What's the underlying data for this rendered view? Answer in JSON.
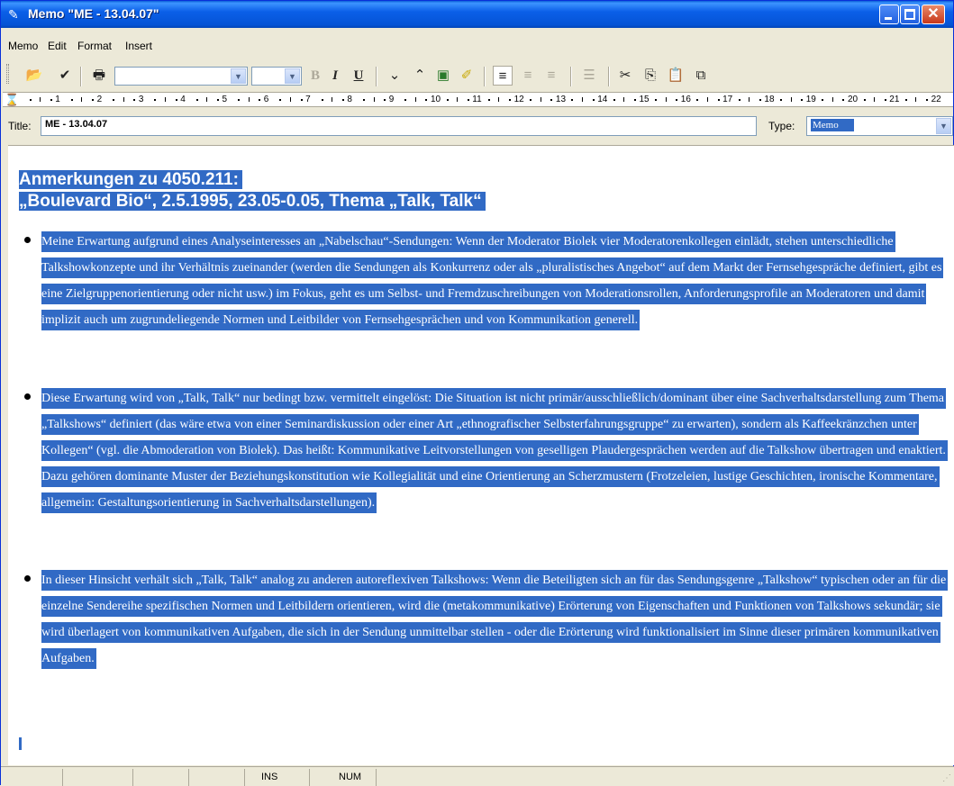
{
  "window": {
    "title": "Memo \"ME - 13.04.07\"",
    "close_glyph": "✕"
  },
  "menu": [
    "Memo",
    "Edit",
    "Format",
    "Insert"
  ],
  "toolbar": {
    "font_name": "",
    "font_size": "",
    "bold_label": "B",
    "italic_label": "I",
    "underline_label": "U",
    "icons": [
      "open-icon",
      "check-icon",
      "print-icon",
      "font-combo",
      "size-combo",
      "bold-icon",
      "italic-icon",
      "underline-icon",
      "move-down-icon",
      "move-up-icon",
      "color-icon",
      "highlight-icon",
      "align-left-icon",
      "align-center-icon",
      "align-right-icon",
      "bullets-icon",
      "cut-icon",
      "copy-icon",
      "paste-icon",
      "paste-special-icon"
    ]
  },
  "ruler": {
    "numbers": [
      "1",
      "2",
      "3",
      "4",
      "5",
      "6",
      "7",
      "8",
      "9",
      "10",
      "11",
      "12",
      "13",
      "14",
      "15",
      "16",
      "17",
      "18",
      "19",
      "20",
      "21",
      "22"
    ]
  },
  "fields": {
    "title_label": "Title:",
    "title_value": "ME - 13.04.07",
    "type_label": "Type:",
    "type_value": "Memo"
  },
  "memo": {
    "heading_line1": "Anmerkungen zu 4050.211:",
    "heading_line2": "„Boulevard Bio“, 2.5.1995, 23.05-0.05, Thema „Talk, Talk“",
    "bullets": [
      "Meine Erwartung aufgrund eines Analyseinteresses an „Nabelschau“-Sendungen: Wenn der Moderator Biolek vier Moderatorenkollegen einlädt, stehen unterschiedliche Talkshowkonzepte und ihr Verhältnis zueinander (werden die Sendungen als Konkurrenz oder als „pluralistisches Angebot“ auf dem Markt der Fernsehgespräche definiert, gibt es eine Zielgruppenorientierung oder nicht usw.) im Fokus, geht es um Selbst- und Fremdzuschreibungen von Moderationsrollen, Anforderungsprofile an Moderatoren und damit implizit auch um zugrundeliegende Normen und Leitbilder von Fernsehgesprächen und von Kommunikation generell.",
      "Diese Erwartung wird von „Talk, Talk“ nur bedingt bzw. vermittelt eingelöst: Die Situation ist nicht primär/ausschließlich/dominant über eine Sachverhaltsdarstellung zum Thema „Talkshows“ definiert (das wäre etwa von einer Seminardiskussion oder einer Art „ethnografischer Selbsterfahrungsgruppe“ zu erwarten), sondern als Kaffeekränzchen unter Kollegen“ (vgl. die Abmoderation von Biolek). Das heißt: Kommunikative Leitvorstellungen von geselligen Plaudergesprächen werden auf die Talkshow übertragen und enaktiert. Dazu gehören dominante Muster der Beziehungskonstitution wie Kollegialität und eine Orientierung an Scherzmustern (Frotzeleien, lustige Geschichten, ironische Kommentare, allgemein: Gestaltungsorientierung in Sachverhaltsdarstellungen).",
      "In dieser Hinsicht verhält sich „Talk, Talk“ analog zu anderen autoreflexiven Talkshows: Wenn die Beteiligten sich an für das Sendungsgenre „Talkshow“ typischen oder an für die einzelne Sendereihe spezifischen Normen und Leitbildern orientieren, wird die (metakommunikative) Erörterung von Eigenschaften und Funktionen von Talkshows sekundär; sie wird überlagert von kommunikativen Aufgaben, die sich in der Sendung unmittelbar stellen - oder die Erörterung wird funktionalisiert im Sinne dieser primären kommunikativen Aufgaben."
    ]
  },
  "status": {
    "ins": "INS",
    "num": "NUM"
  },
  "colors": {
    "selection": "#316ac5",
    "titlebar": "#0554d6"
  }
}
